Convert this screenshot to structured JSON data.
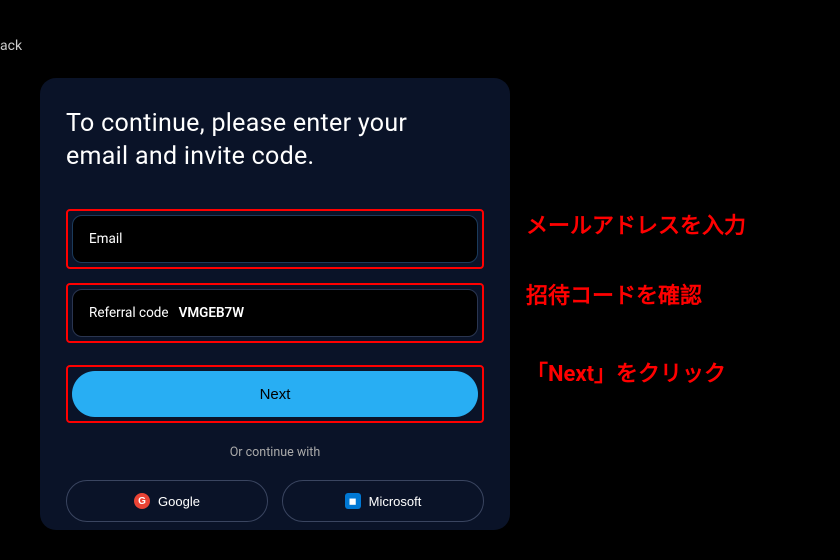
{
  "back": "ack",
  "heading_line1": "To continue, please enter your",
  "heading_line2": "email and invite code.",
  "email": {
    "placeholder": "Email",
    "value": ""
  },
  "referral": {
    "label": "Referral code",
    "value": "VMGEB7W"
  },
  "next_label": "Next",
  "divider_text": "Or continue with",
  "oauth": {
    "google": {
      "label": "Google",
      "glyph": "G"
    },
    "microsoft": {
      "label": "Microsoft",
      "glyph": "◼"
    }
  },
  "annotations": {
    "email": "メールアドレスを入力",
    "referral": "招待コードを確認",
    "next": "「Next」をクリック"
  }
}
